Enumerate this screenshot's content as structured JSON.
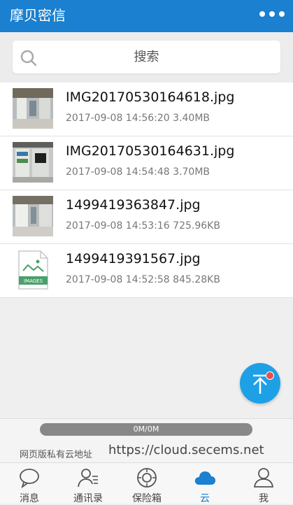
{
  "header": {
    "title": "摩贝密信"
  },
  "search": {
    "placeholder": "搜索"
  },
  "files": [
    {
      "name": "IMG20170530164618.jpg",
      "date": "2017-09-08 14:56:20",
      "size": "3.40MB",
      "thumb": "photo-icon"
    },
    {
      "name": "IMG20170530164631.jpg",
      "date": "2017-09-08 14:54:48",
      "size": "3.70MB",
      "thumb": "photo-icon"
    },
    {
      "name": "1499419363847.jpg",
      "date": "2017-09-08 14:53:16",
      "size": "725.96KB",
      "thumb": "photo-icon"
    },
    {
      "name": "1499419391567.jpg",
      "date": "2017-09-08 14:52:58",
      "size": "845.28KB",
      "thumb": "image-file-icon",
      "thumb_label": "IMAGES"
    }
  ],
  "storage": {
    "usage_text": "0M/0M",
    "used_fraction": 0
  },
  "web": {
    "label": "网页版私有云地址",
    "url": "https://cloud.secems.net"
  },
  "tabs": [
    {
      "label": "消息",
      "icon": "chat-bubble-icon"
    },
    {
      "label": "通讯录",
      "icon": "contacts-icon"
    },
    {
      "label": "保险箱",
      "icon": "safe-icon"
    },
    {
      "label": "云",
      "icon": "cloud-icon",
      "active": true
    },
    {
      "label": "我",
      "icon": "person-icon"
    }
  ],
  "colors": {
    "accent": "#1a80cf",
    "fab": "#1ea0e6",
    "badge": "#e8504a"
  }
}
